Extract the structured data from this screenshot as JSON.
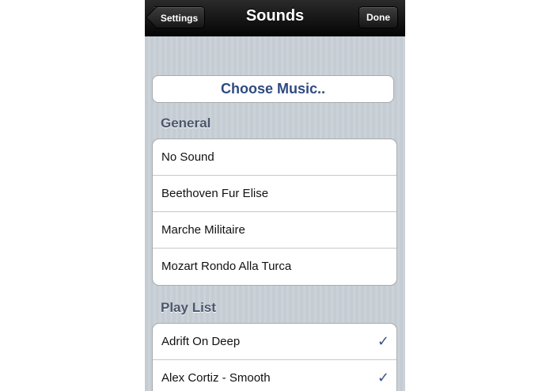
{
  "nav": {
    "title": "Sounds",
    "back_label": "Settings",
    "done_label": "Done"
  },
  "choose_music_label": "Choose Music..",
  "sections": {
    "general": {
      "header": "General",
      "items": [
        {
          "label": "No Sound",
          "checked": false
        },
        {
          "label": "Beethoven Fur Elise",
          "checked": false
        },
        {
          "label": "Marche Militaire",
          "checked": false
        },
        {
          "label": "Mozart Rondo Alla Turca",
          "checked": false
        }
      ]
    },
    "playlist": {
      "header": "Play List",
      "items": [
        {
          "label": "Adrift On Deep",
          "checked": true,
          "check_glyph": "✓"
        },
        {
          "label": "Alex Cortiz - Smooth",
          "checked": true,
          "check_glyph": "✓"
        }
      ]
    }
  },
  "colors": {
    "accent_text": "#2f4a82",
    "checkmark": "#385487",
    "section_header": "#4c566c"
  }
}
